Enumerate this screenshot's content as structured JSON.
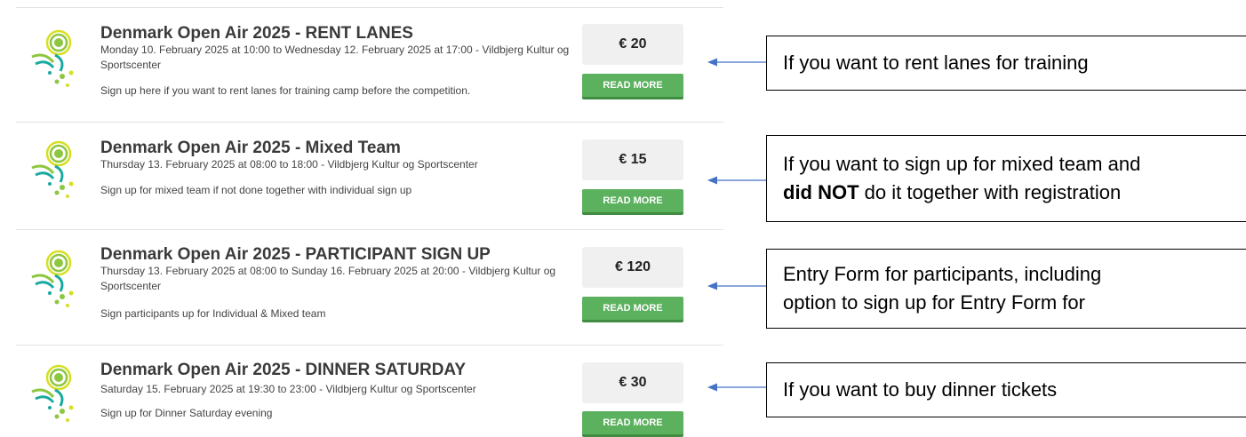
{
  "colors": {
    "button_green": "#5cb15e",
    "price_bg": "#f0f0f0",
    "arrow_blue": "#4472c4",
    "logo_green": "#8dc63f",
    "logo_teal": "#1aa9a0",
    "logo_yellow": "#d7df23"
  },
  "events": [
    {
      "title": "Denmark Open Air 2025 - RENT LANES",
      "dates": "Monday 10. February 2025 at 10:00 to Wednesday 12. February 2025 at 17:00 - Vildbjerg Kultur og Sportscenter",
      "description": "Sign up here if you want to rent lanes for training camp before the competition.",
      "price": "€ 20",
      "button": "READ MORE",
      "logo_icon": "event-logo-icon"
    },
    {
      "title": "Denmark Open Air 2025 - Mixed Team",
      "dates": "Thursday 13. February 2025 at 08:00 to 18:00 - Vildbjerg Kultur og Sportscenter",
      "description": "Sign up for mixed team if not done together with individual sign up",
      "price": "€ 15",
      "button": "READ MORE",
      "logo_icon": "event-logo-icon"
    },
    {
      "title": "Denmark Open Air 2025 - PARTICIPANT SIGN UP",
      "dates": "Thursday 13. February 2025 at 08:00 to Sunday 16. February 2025 at 20:00 - Vildbjerg Kultur og Sportscenter",
      "description": "Sign participants up for Individual & Mixed team",
      "price": "€ 120",
      "button": "READ MORE",
      "logo_icon": "event-logo-icon"
    },
    {
      "title": "Denmark Open Air 2025 - DINNER SATURDAY",
      "dates": "Saturday 15. February 2025 at 19:30 to 23:00 - Vildbjerg Kultur og Sportscenter",
      "description": "Sign up for Dinner Saturday evening",
      "price": "€ 30",
      "button": "READ MORE",
      "logo_icon": "event-logo-icon"
    }
  ],
  "callouts": [
    {
      "line1": "If you want to rent lanes for training"
    },
    {
      "line1": "If you want to sign up for mixed team and",
      "line2_bold": "did NOT",
      "line2_rest": " do it together with registration"
    },
    {
      "line1": "Entry Form for participants, including",
      "line2": "option to sign up for Entry Form for"
    },
    {
      "line1": "If you want to buy dinner tickets"
    }
  ]
}
